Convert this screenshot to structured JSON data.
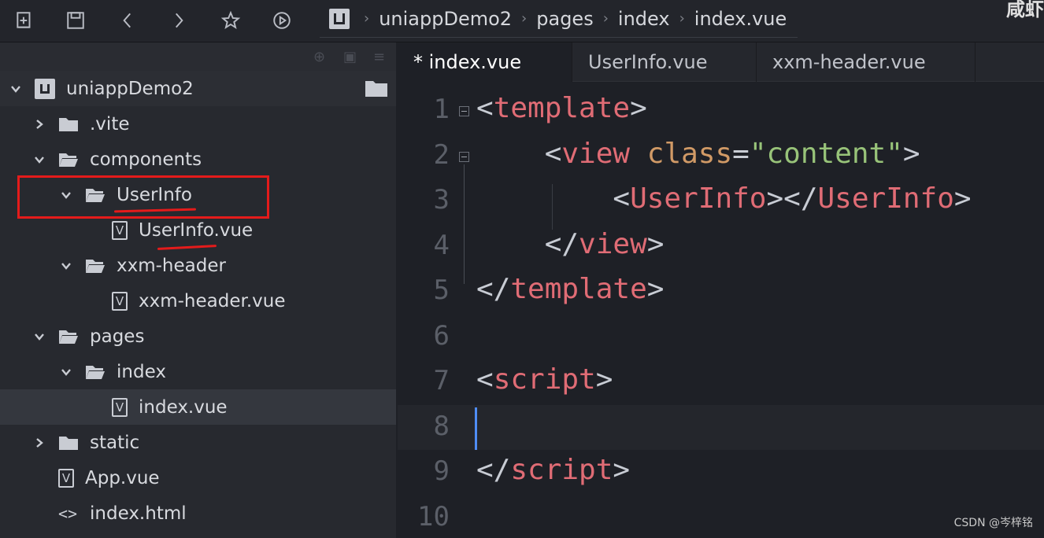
{
  "toolbar": {
    "buttons": [
      {
        "name": "new-file-icon"
      },
      {
        "name": "save-icon"
      },
      {
        "name": "back-icon"
      },
      {
        "name": "forward-icon"
      },
      {
        "name": "star-icon"
      },
      {
        "name": "run-icon"
      }
    ],
    "breadcrumb": [
      "uniappDemo2",
      "pages",
      "index",
      "index.vue"
    ],
    "corner_text": "咸虾"
  },
  "tree": {
    "root": "uniappDemo2",
    "items": [
      {
        "label": ".vite",
        "type": "folder",
        "expanded": false,
        "depth": 1
      },
      {
        "label": "components",
        "type": "folder",
        "expanded": true,
        "depth": 1
      },
      {
        "label": "UserInfo",
        "type": "folder",
        "expanded": true,
        "depth": 2
      },
      {
        "label": "UserInfo.vue",
        "type": "vue",
        "depth": 3
      },
      {
        "label": "xxm-header",
        "type": "folder",
        "expanded": true,
        "depth": 2
      },
      {
        "label": "xxm-header.vue",
        "type": "vue",
        "depth": 3
      },
      {
        "label": "pages",
        "type": "folder",
        "expanded": true,
        "depth": 1
      },
      {
        "label": "index",
        "type": "folder",
        "expanded": true,
        "depth": 2
      },
      {
        "label": "index.vue",
        "type": "vue",
        "depth": 3,
        "selected": true
      },
      {
        "label": "static",
        "type": "folder",
        "expanded": false,
        "depth": 1
      },
      {
        "label": "App.vue",
        "type": "vue",
        "depth": 1
      },
      {
        "label": "index.html",
        "type": "html",
        "depth": 1
      }
    ]
  },
  "tabs": [
    {
      "label": "* index.vue",
      "active": true
    },
    {
      "label": "UserInfo.vue",
      "active": false
    },
    {
      "label": "xxm-header.vue",
      "active": false
    }
  ],
  "code": {
    "line_numbers": [
      "1",
      "2",
      "3",
      "4",
      "5",
      "6",
      "7",
      "8",
      "9",
      "10"
    ],
    "lines": [
      [
        [
          "br",
          "<"
        ],
        [
          "tag",
          "template"
        ],
        [
          "br",
          ">"
        ]
      ],
      [
        [
          "br",
          "    <"
        ],
        [
          "tag",
          "view"
        ],
        [
          "br",
          " "
        ],
        [
          "attr",
          "class"
        ],
        [
          "eq",
          "="
        ],
        [
          "str",
          "\"content\""
        ],
        [
          "br",
          ">"
        ]
      ],
      [
        [
          "br",
          "        <"
        ],
        [
          "tag",
          "UserInfo"
        ],
        [
          "br",
          "></"
        ],
        [
          "tag",
          "UserInfo"
        ],
        [
          "br",
          ">"
        ]
      ],
      [
        [
          "br",
          "    </"
        ],
        [
          "tag",
          "view"
        ],
        [
          "br",
          ">"
        ]
      ],
      [
        [
          "br",
          "</"
        ],
        [
          "tag",
          "template"
        ],
        [
          "br",
          ">"
        ]
      ],
      [],
      [
        [
          "br",
          "<"
        ],
        [
          "tag",
          "script"
        ],
        [
          "br",
          ">"
        ]
      ],
      [],
      [
        [
          "br",
          "</"
        ],
        [
          "tag",
          "script"
        ],
        [
          "br",
          ">"
        ]
      ],
      []
    ]
  },
  "watermark": "CSDN @岑梓铭",
  "colors": {
    "tag": "#e06c75",
    "attr": "#d19a66",
    "string": "#98c379",
    "cursor": "#4f8df5",
    "annotation": "#e41b1b"
  }
}
